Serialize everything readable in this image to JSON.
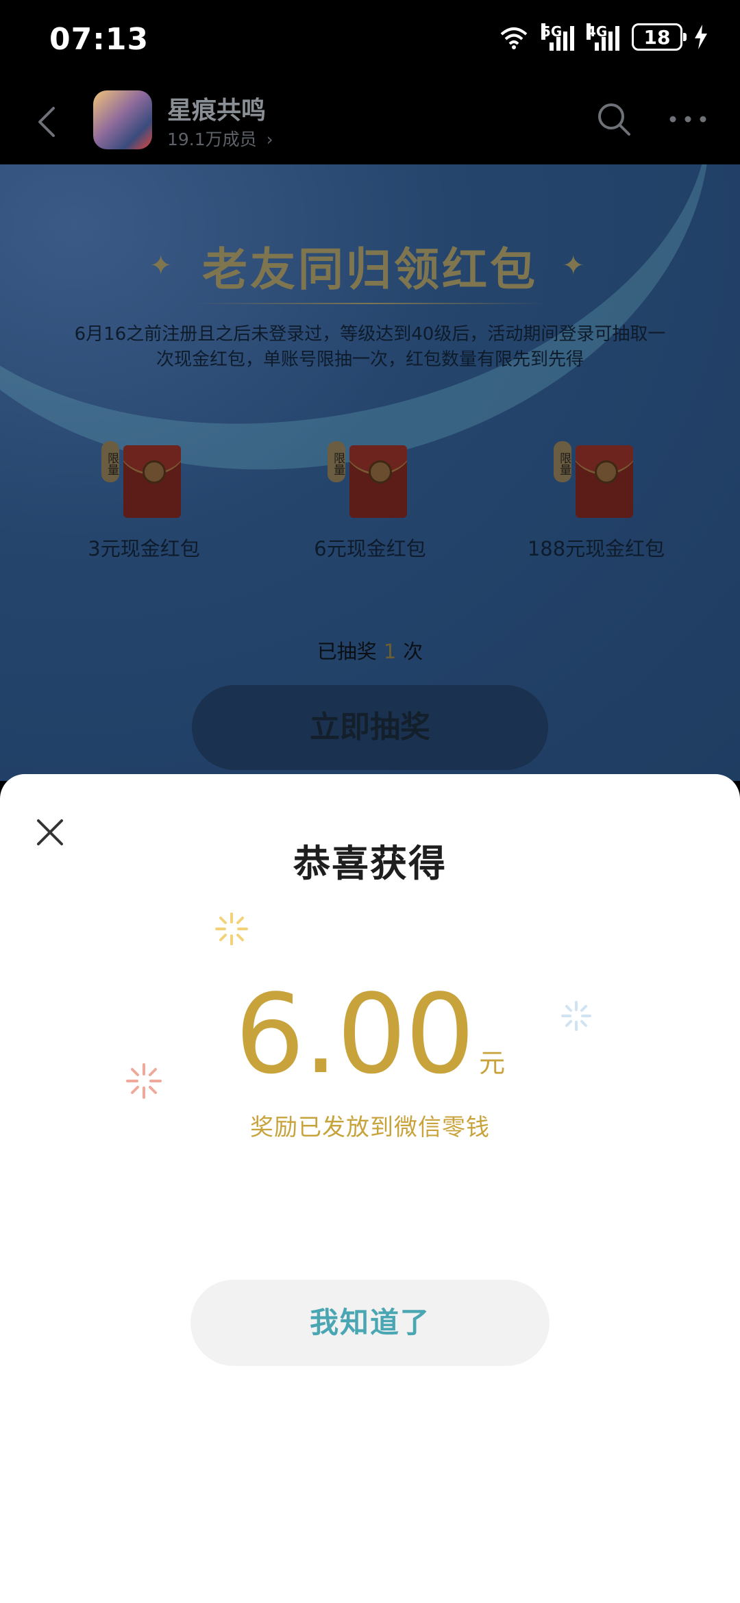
{
  "status_bar": {
    "time": "07:13",
    "network_tags": [
      "6",
      "5G",
      "4G"
    ],
    "battery": "18"
  },
  "header": {
    "title": "星痕共鸣",
    "members": "19.1万成员",
    "members_chevron": "›",
    "icons": [
      "back-icon",
      "search-icon",
      "more-icon"
    ]
  },
  "event": {
    "title": "老友同归领红包",
    "description": "6月16之前注册且之后未登录过，等级达到40级后，活动期间登录可抽取一次现金红包，单账号限抽一次，红包数量有限先到先得",
    "limit_tag": "限量",
    "prizes": [
      {
        "label": "3元现金红包"
      },
      {
        "label": "6元现金红包"
      },
      {
        "label": "188元现金红包"
      }
    ],
    "draw_count_prefix": "已抽奖",
    "draw_count": "1",
    "draw_count_suffix": "次",
    "draw_button": "立即抽奖"
  },
  "dialog": {
    "title": "恭喜获得",
    "amount": "6.00",
    "unit": "元",
    "note": "奖励已发放到微信零钱",
    "confirm_button": "我知道了"
  },
  "colors": {
    "accent_gold": "#c8a33c",
    "button_text_teal": "#4aa6b2",
    "sheet_bg": "#ffffff"
  }
}
